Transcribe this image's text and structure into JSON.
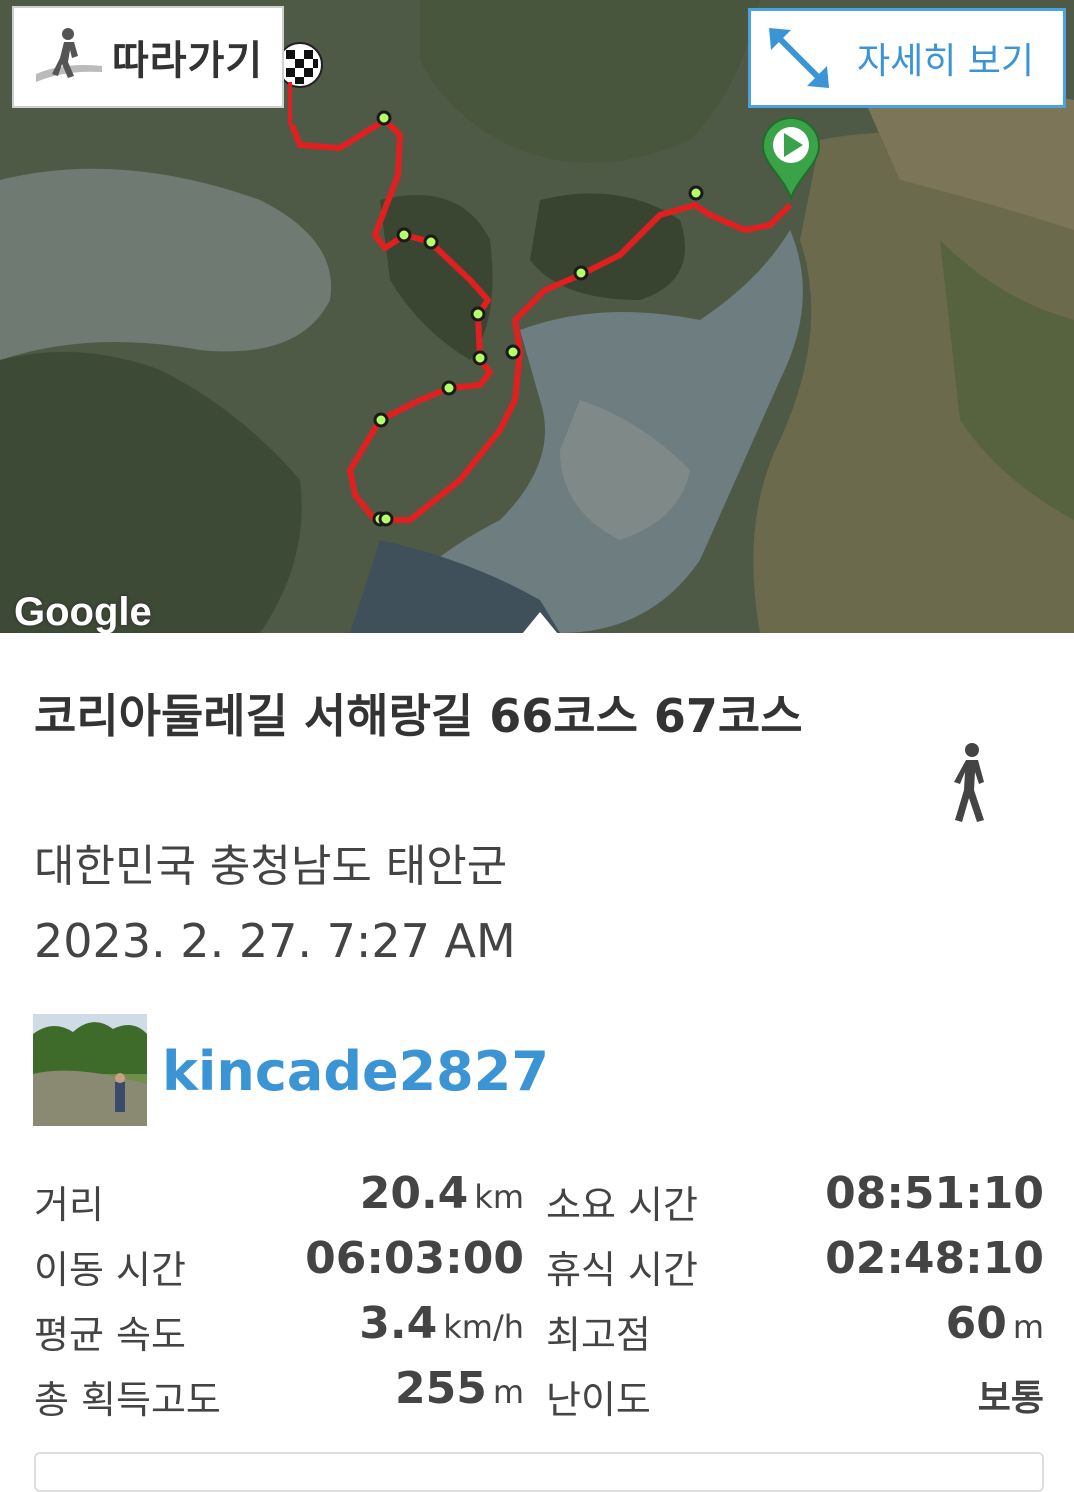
{
  "map": {
    "follow_label": "따라가기",
    "detail_label": "자세히 보기",
    "google_label": "Google",
    "route_color": "#e02020",
    "start_marker_color": "#3aa34a"
  },
  "course": {
    "title": "코리아둘레길 서해랑길 66코스 67코스",
    "region": "대한민국 충청남도 태안군",
    "date": "2023. 2. 27. 7:27 AM",
    "activity_icon": "walking-icon"
  },
  "user": {
    "name": "kincade2827"
  },
  "stats": {
    "distance_label": "거리",
    "distance_value": "20.4",
    "distance_unit": "km",
    "total_time_label": "소요 시간",
    "total_time_value": "08:51:10",
    "moving_time_label": "이동 시간",
    "moving_time_value": "06:03:00",
    "rest_time_label": "휴식 시간",
    "rest_time_value": "02:48:10",
    "avg_speed_label": "평균 속도",
    "avg_speed_value": "3.4",
    "avg_speed_unit": "km/h",
    "max_alt_label": "최고점",
    "max_alt_value": "60",
    "max_alt_unit": "m",
    "elev_gain_label": "총 획득고도",
    "elev_gain_value": "255",
    "elev_gain_unit": "m",
    "difficulty_label": "난이도",
    "difficulty_value": "보통"
  }
}
